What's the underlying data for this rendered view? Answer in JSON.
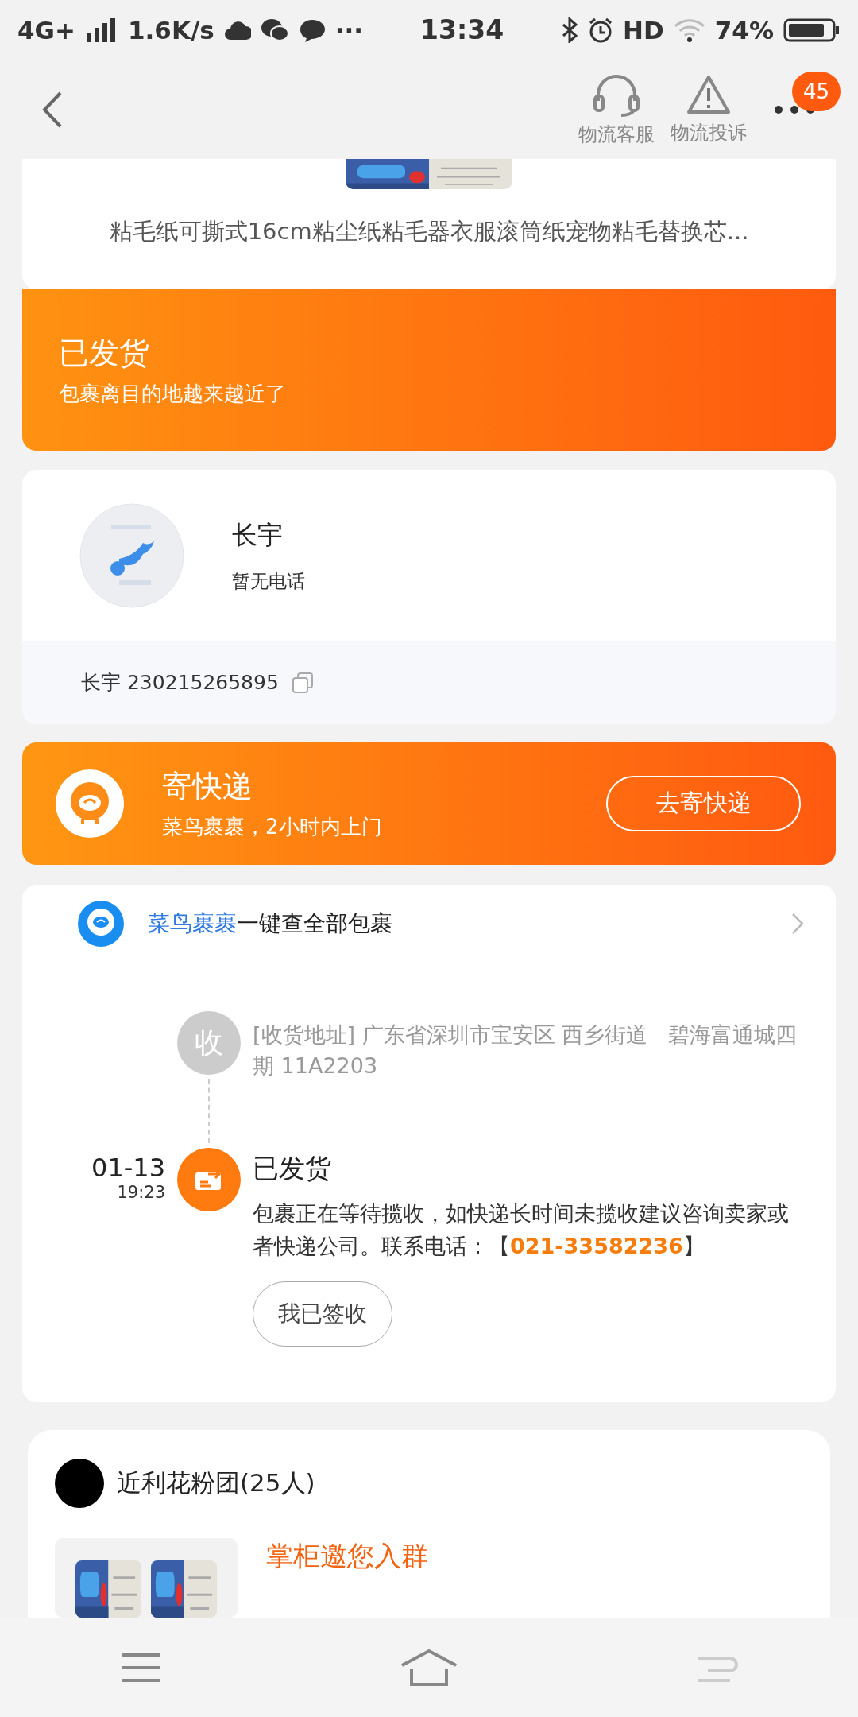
{
  "status_bar": {
    "network": "4G+",
    "speed": "1.6K/s",
    "more": "···",
    "time": "13:34",
    "hd": "HD",
    "battery": "74%"
  },
  "header": {
    "actions": [
      {
        "label": "物流客服",
        "kind": "headset"
      },
      {
        "label": "物流投诉",
        "kind": "warning"
      }
    ],
    "badge": "45"
  },
  "product": {
    "title": "粘毛纸可撕式16cm粘尘纸粘毛器衣服滚筒纸宠物粘毛替换芯..."
  },
  "status_banner": {
    "title": "已发货",
    "subtitle": "包裹离目的地越来越近了"
  },
  "receiver": {
    "name": "长宇",
    "phone": "暂无电话",
    "tracking": "长宇 230215265895"
  },
  "send_card": {
    "title": "寄快递",
    "subtitle": "菜鸟裹裹，2小时内上门",
    "button": "去寄快递"
  },
  "tracking": {
    "link": "菜鸟裹裹",
    "text": "一键查全部包裹",
    "events": [
      {
        "kind": "address",
        "node": "收",
        "text": "[收货地址] 广东省深圳市宝安区 西乡街道   碧海富通城四期 11A2203"
      },
      {
        "kind": "status",
        "date": "01-13",
        "time": "19:23",
        "title": "已发货",
        "text": "包裹正在等待揽收，如快递长时间未揽收建议咨询卖家或者快递公司。联系电话：【",
        "phone": "021-33582236",
        "text_end": "】",
        "button": "我已签收"
      }
    ]
  },
  "group": {
    "name": "近利花粉团(25人)",
    "invite": "掌柜邀您入群"
  }
}
